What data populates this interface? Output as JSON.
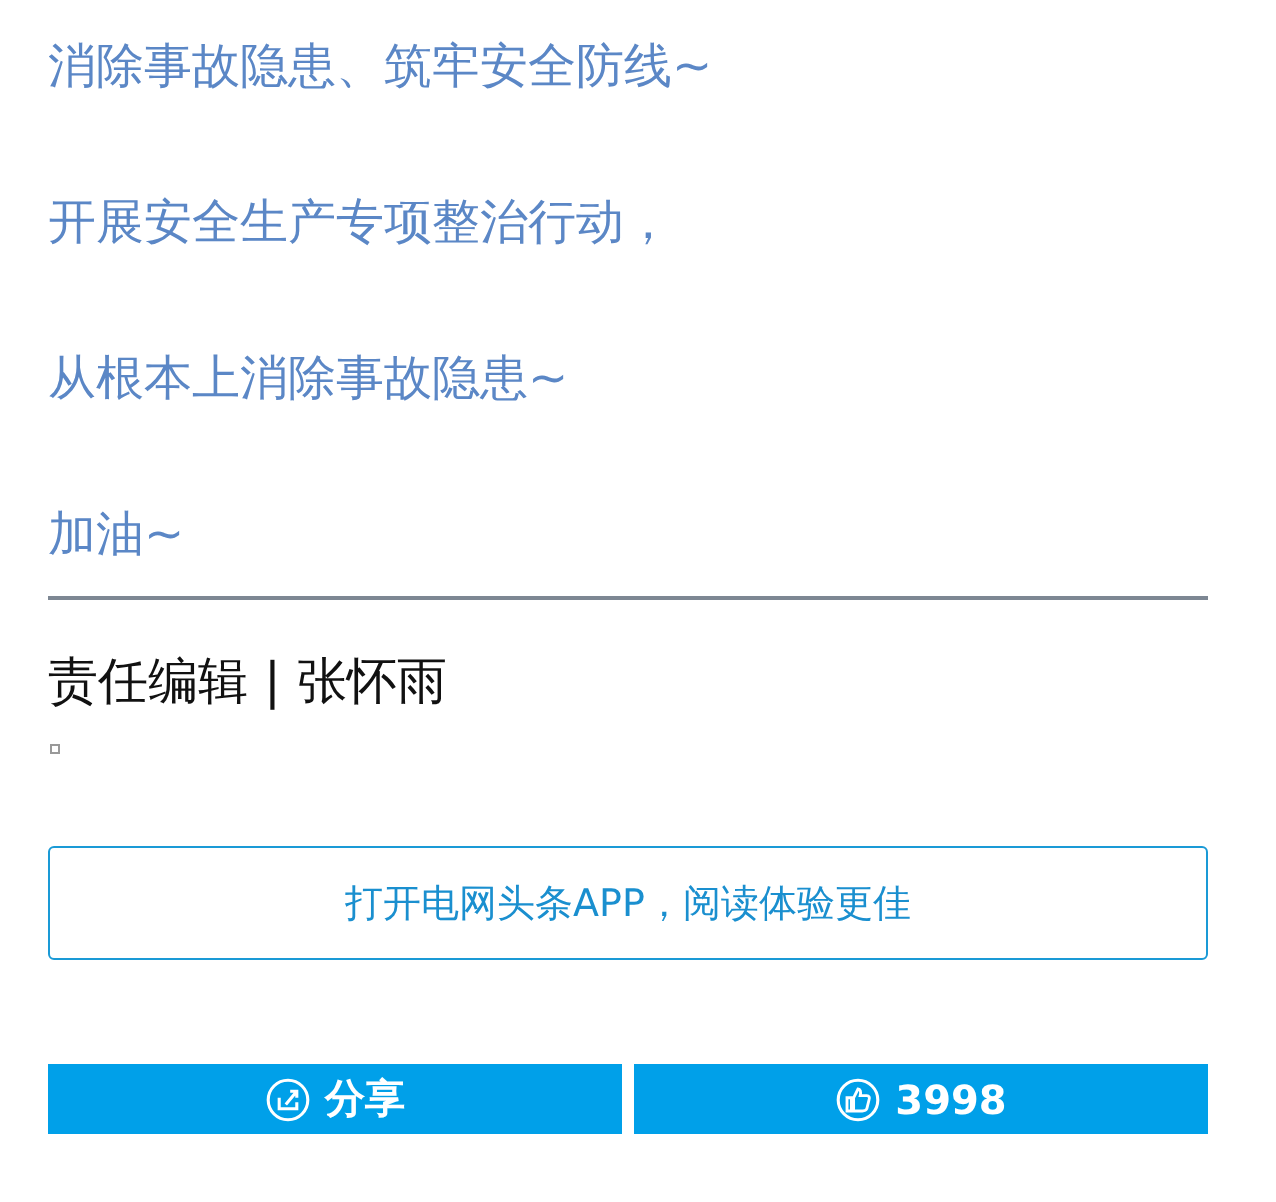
{
  "paragraphs": [
    "消除事故隐患、筑牢安全防线~",
    "开展安全生产专项整治行动，",
    "从根本上消除事故隐患~",
    "加油~"
  ],
  "editor": "责任编辑 | 张怀雨",
  "open_app_button": "打开电网头条APP，阅读体验更佳",
  "actions": [
    {
      "kind": "share",
      "label": "分享"
    },
    {
      "kind": "like",
      "label": "3998"
    }
  ]
}
